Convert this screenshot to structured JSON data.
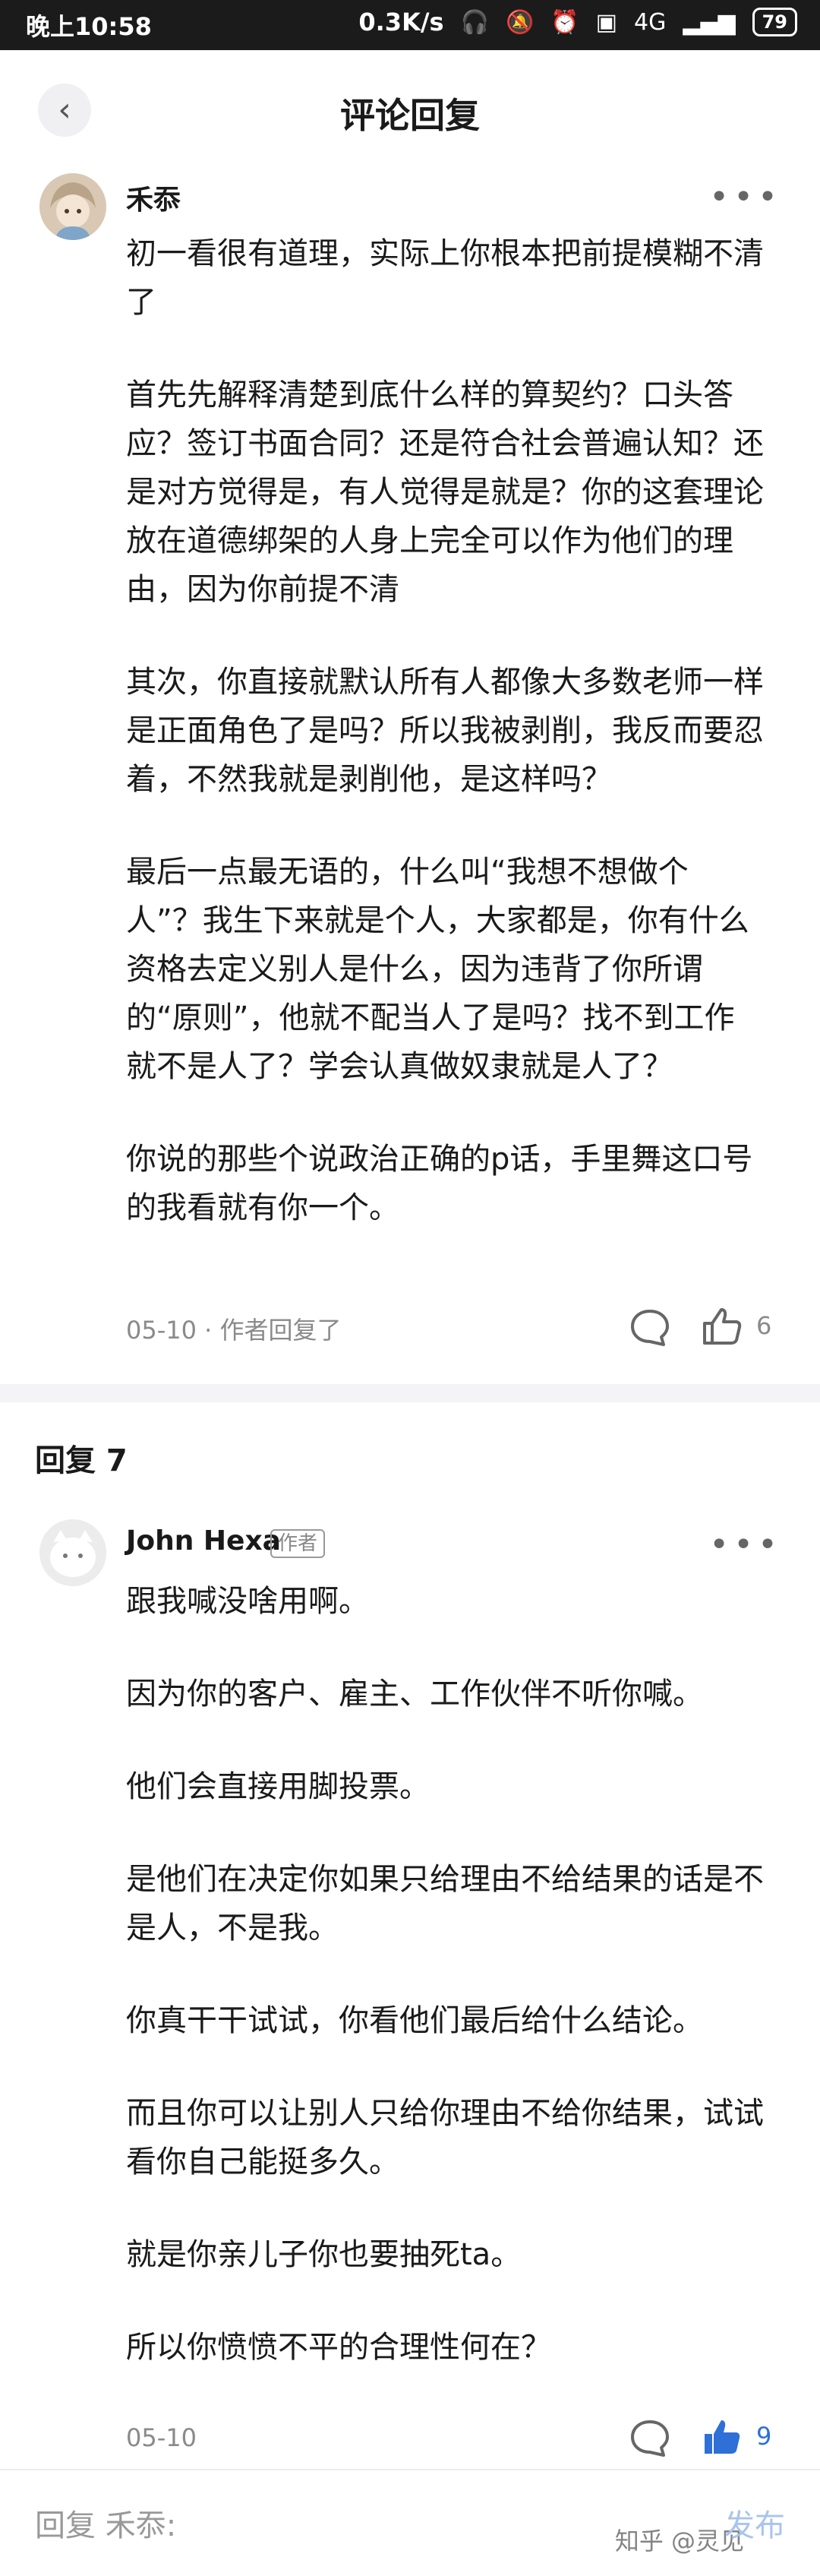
{
  "status_bar": {
    "time": "晚上10:58",
    "net_speed": "0.3K/s",
    "network": "4G",
    "battery": "79"
  },
  "header": {
    "title": "评论回复"
  },
  "main_comment": {
    "username": "禾忝",
    "paragraphs": [
      "初一看很有道理，实际上你根本把前提模糊不清了",
      "首先先解释清楚到底什么样的算契约？口头答应？签订书面合同？还是符合社会普遍认知？还是对方觉得是，有人觉得是就是？你的这套理论放在道德绑架的人身上完全可以作为他们的理由，因为你前提不清",
      "其次，你直接就默认所有人都像大多数老师一样是正面角色了是吗？所以我被剥削，我反而要忍着，不然我就是剥削他，是这样吗？",
      "最后一点最无语的，什么叫“我想不想做个人”？我生下来就是个人，大家都是，你有什么资格去定义别人是什么，因为违背了你所谓的“原则”，他就不配当人了是吗？找不到工作就不是人了？学会认真做奴隶就是人了？",
      "你说的那些个说政治正确的p话，手里舞这口号的我看就有你一个。"
    ],
    "meta": "05-10 · 作者回复了",
    "likes": "6"
  },
  "replies_header": "回复 7",
  "reply": {
    "username": "John Hexa",
    "badge": "作者",
    "paragraphs": [
      "跟我喊没啥用啊。",
      "因为你的客户、雇主、工作伙伴不听你喊。",
      "他们会直接用脚投票。",
      "是他们在决定你如果只给理由不给结果的话是不是人，不是我。",
      "你真干干试试，你看他们最后给什么结论。",
      "而且你可以让别人只给你理由不给你结果，试试看你自己能挺多久。",
      "就是你亲儿子你也要抽死ta。",
      "所以你愤愤不平的合理性何在？"
    ],
    "meta": "05-10",
    "likes": "9"
  },
  "bottom_bar": {
    "placeholder": "回复 禾忝:",
    "publish": "发布",
    "watermark": "知乎 @灵见"
  },
  "colors": {
    "accent": "#2e6fd8",
    "muted": "#8a8a8a"
  }
}
